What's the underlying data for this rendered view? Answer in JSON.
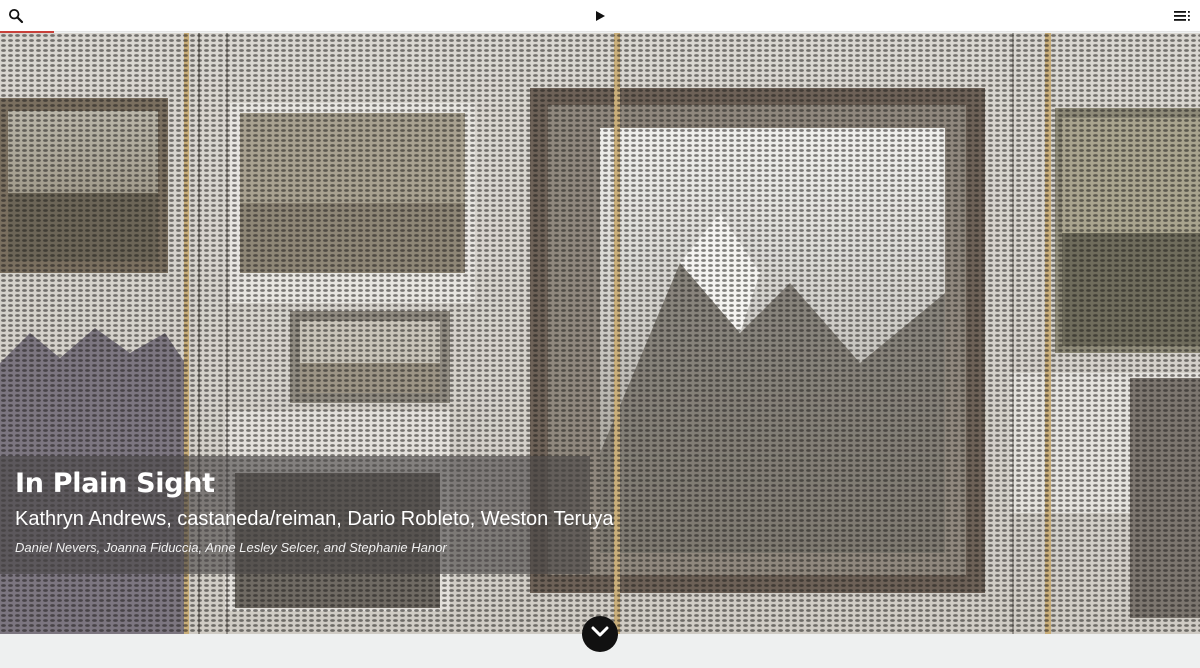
{
  "topbar": {
    "search_icon": "search-icon",
    "play_icon": "play-icon",
    "menu_icon": "menu-list-icon",
    "progress_fraction": 0.045,
    "progress_color": "#c8413a"
  },
  "hero": {
    "description_icon": "hero-photo",
    "title": "In Plain Sight",
    "artists": "Kathryn Andrews, castaneda/reiman, Dario Robleto, Weston Teruya",
    "authors": "Daniel Nevers, Joanna Fiduccia, Anne Lesley Selcer, and Stephanie Hanor"
  },
  "scroll_down": {
    "icon": "chevron-down-icon"
  }
}
